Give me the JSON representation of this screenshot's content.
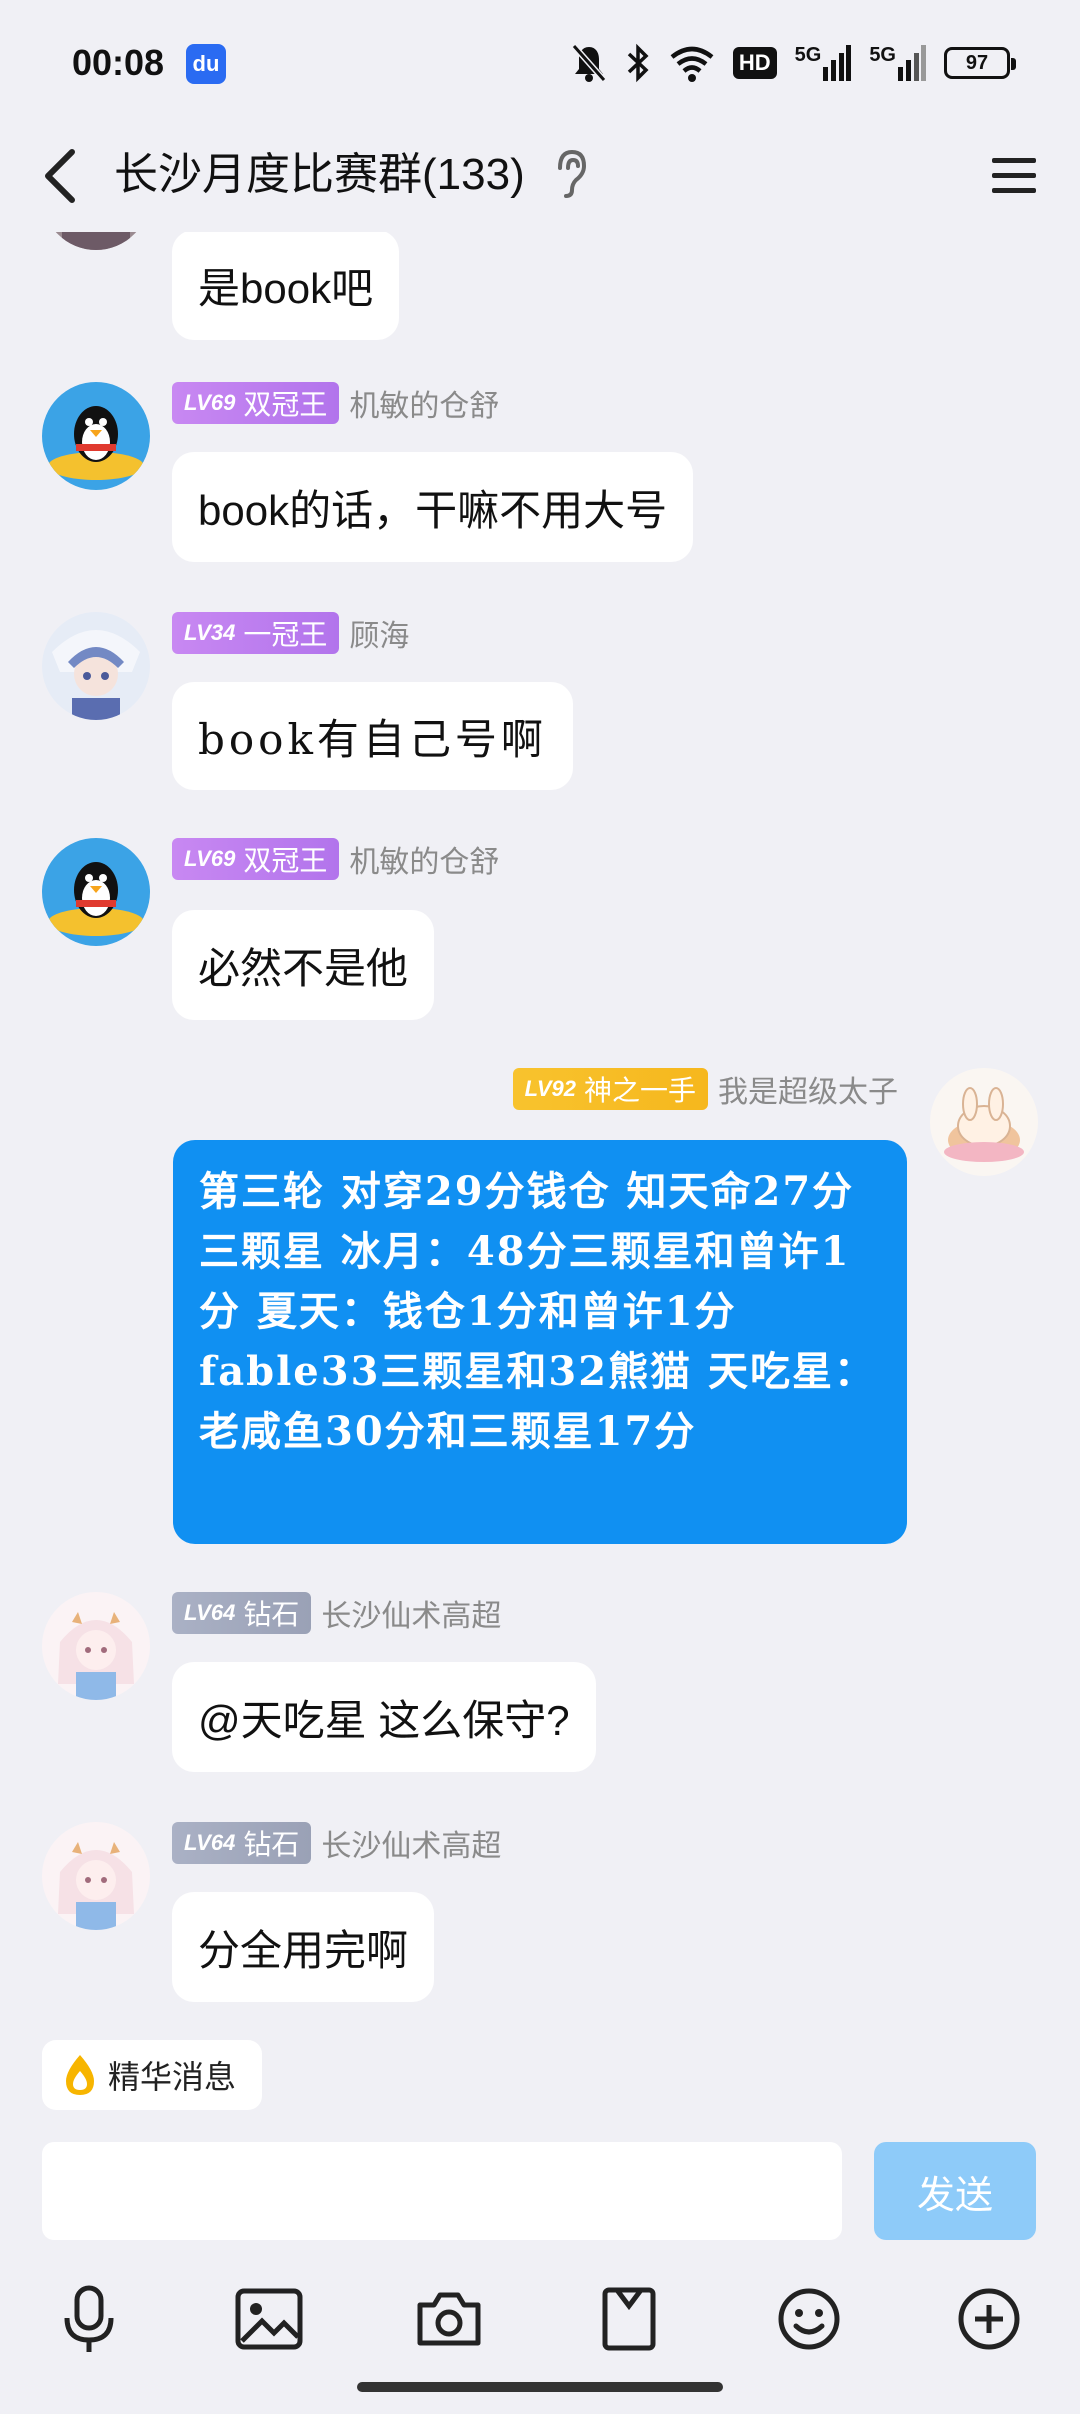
{
  "status_bar": {
    "time": "00:08",
    "app_icon_text": "du",
    "hd_label": "HD",
    "net1": "5G",
    "net2": "5G",
    "battery": "97"
  },
  "header": {
    "title": "长沙月度比赛群(133)"
  },
  "messages": [
    {
      "text": "是book吧"
    },
    {
      "level": "LV69",
      "title": "双冠王",
      "nick": "机敏的仓舒",
      "text": "book的话，干嘛不用大号"
    },
    {
      "level": "LV34",
      "title": "一冠王",
      "nick": "顾海",
      "text": "book有自己号啊"
    },
    {
      "level": "LV69",
      "title": "双冠王",
      "nick": "机敏的仓舒",
      "text": "必然不是他"
    },
    {
      "level": "LV92",
      "title": "神之一手",
      "nick": "我是超级太子",
      "text": "第三轮 对穿29分钱仓   知天命27分三颗星   冰月：48分三颗星和曾许1分   夏天：钱仓1分和曾许1分  fable33三颗星和32熊猫 天吃星：老咸鱼30分和三颗星17分"
    },
    {
      "level": "LV64",
      "title": "钻石",
      "nick": "长沙仙术高超",
      "text": "@天吃星 这么保守?"
    },
    {
      "level": "LV64",
      "title": "钻石",
      "nick": "长沙仙术高超",
      "text": "分全用完啊"
    }
  ],
  "essence": {
    "label": "精华消息"
  },
  "composer": {
    "input_value": "",
    "send_label": "发送"
  },
  "icons": {
    "back": "chevron-left-icon",
    "menu": "menu-icon",
    "ear": "ear-icon",
    "voice": "microphone-icon",
    "image": "image-icon",
    "camera": "camera-icon",
    "file": "file-icon",
    "emoji": "emoji-icon",
    "plus": "plus-icon",
    "essence": "flame-icon"
  },
  "colors": {
    "accent": "#1090f2",
    "send_disabled": "#8ecbf9",
    "badge_purple": "#c084f0",
    "badge_gold": "#f8c32e",
    "badge_gray": "#a6adc0"
  }
}
